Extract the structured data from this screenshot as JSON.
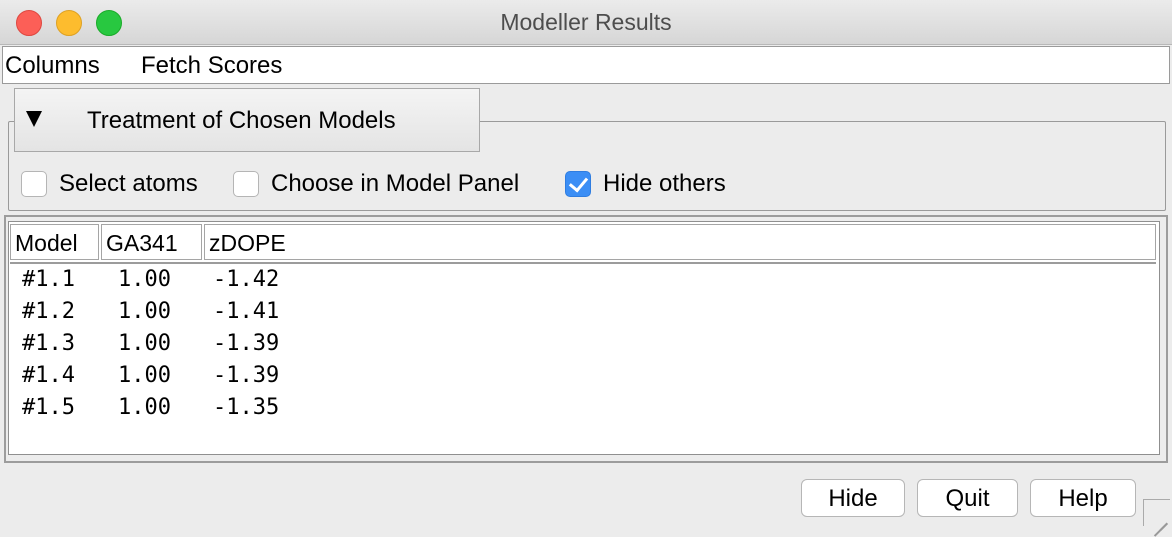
{
  "window": {
    "title": "Modeller Results"
  },
  "menu": {
    "items": [
      "Columns",
      "Fetch Scores"
    ]
  },
  "treatment": {
    "title": "Treatment of Chosen Models",
    "options": [
      {
        "label": "Select atoms",
        "checked": false
      },
      {
        "label": "Choose in Model Panel",
        "checked": false
      },
      {
        "label": "Hide others",
        "checked": true
      }
    ]
  },
  "table": {
    "columns": [
      "Model",
      "GA341",
      "zDOPE"
    ],
    "rows": [
      [
        "#1.1",
        "1.00",
        "-1.42"
      ],
      [
        "#1.2",
        "1.00",
        "-1.41"
      ],
      [
        "#1.3",
        "1.00",
        "-1.39"
      ],
      [
        "#1.4",
        "1.00",
        "-1.39"
      ],
      [
        "#1.5",
        "1.00",
        "-1.35"
      ]
    ]
  },
  "buttons": {
    "hide": "Hide",
    "quit": "Quit",
    "help": "Help"
  },
  "colors": {
    "accent": "#3b8ef5",
    "close": "#fc5f57",
    "minimize": "#fdbc2e",
    "maximize": "#28c840"
  }
}
